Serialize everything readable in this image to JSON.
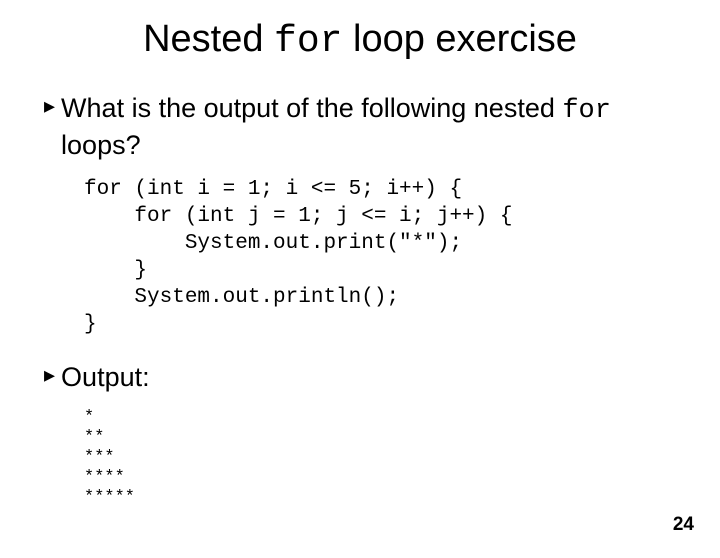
{
  "title": {
    "pre": "Nested ",
    "mono": "for",
    "post": " loop exercise"
  },
  "bullet1": {
    "pre": "What is the output of the following nested ",
    "mono": "for",
    "post": " loops?"
  },
  "code": "for (int i = 1; i <= 5; i++) {\n    for (int j = 1; j <= i; j++) {\n        System.out.print(\"*\");\n    }\n    System.out.println();\n}",
  "bullet2": "Output:",
  "output": "*\n**\n***\n****\n*****",
  "page_number": "24"
}
